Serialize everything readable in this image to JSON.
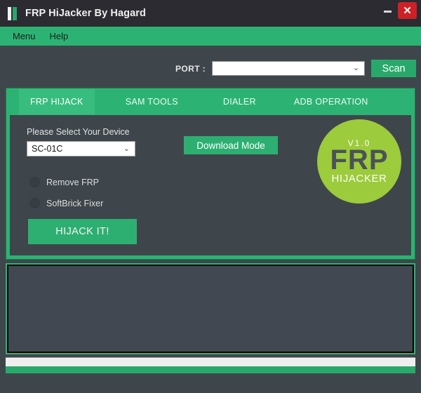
{
  "window": {
    "title": "FRP HiJacker By Hagard",
    "icon": "app-bars-icon",
    "minimize_label": "—",
    "close_label": "✕",
    "close_color": "#cc2127",
    "titlebar_color": "#2b2b31"
  },
  "menubar": {
    "items": [
      {
        "label": "Menu"
      },
      {
        "label": "Help"
      }
    ],
    "color": "#2cb373"
  },
  "toolbar": {
    "port_label": "PORT :",
    "port_value": "",
    "port_placeholder": "",
    "port_chevron": "⌄",
    "scan_label": "Scan",
    "scan_color": "#28a96b"
  },
  "tabs": [
    {
      "label": "FRP HIJACK",
      "active": true
    },
    {
      "label": "SAM TOOLS",
      "active": false
    },
    {
      "label": "DIALER",
      "active": false
    },
    {
      "label": "ADB OPERATION",
      "active": false
    }
  ],
  "panel": {
    "device_label": "Please Select Your Device",
    "device_value": "SC-01C",
    "device_chevron": "⌄",
    "download_mode_label": "Download Mode",
    "options": [
      {
        "label": "Remove FRP",
        "selected": false
      },
      {
        "label": "SoftBrick Fixer",
        "selected": false
      }
    ],
    "hijack_label": "HIJACK IT!"
  },
  "logo": {
    "version": "V1.0",
    "primary": "FRP",
    "secondary": "HIJACKER",
    "circle_color": "#9ccb3b",
    "text_color": "#4a5258"
  },
  "log": {
    "content": ""
  },
  "theme": {
    "accent_green": "#2cb373",
    "panel_bg": "#3e464c",
    "log_bg": "#414851"
  }
}
